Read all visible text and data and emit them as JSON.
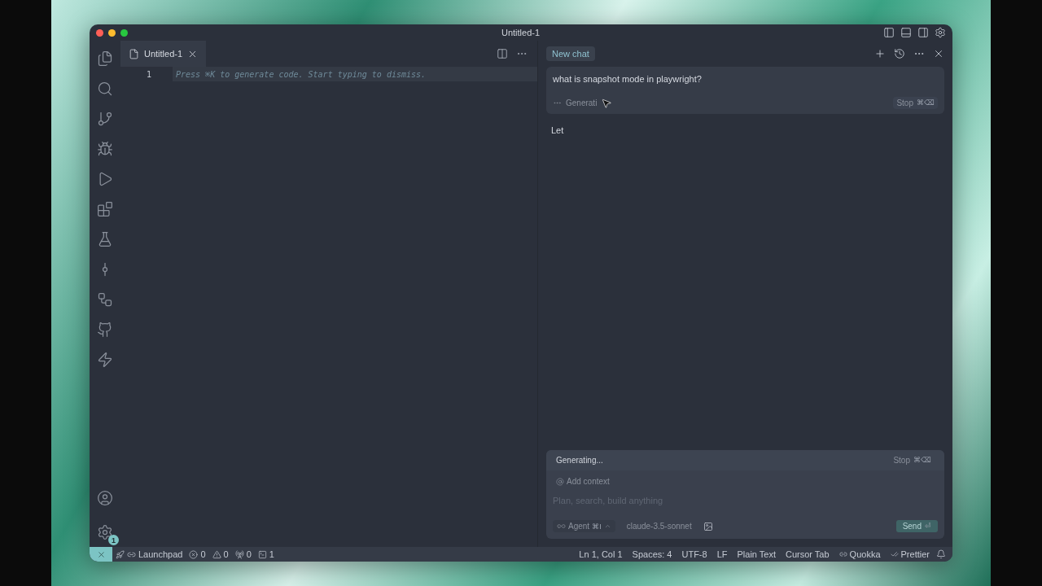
{
  "window": {
    "title": "Untitled-1"
  },
  "activity_bar": {
    "settings_badge": "1"
  },
  "editor": {
    "tabs": [
      {
        "label": "Untitled-1",
        "selected": true
      }
    ],
    "lines": [
      {
        "number": "1",
        "hint": "Press ⌘K to generate code. Start typing to dismiss."
      }
    ]
  },
  "chat": {
    "tab": "New chat",
    "message": "what is snapshot mode in playwright?",
    "status": "Generati",
    "stop": "Stop",
    "stop_shortcut": "⌘⌫",
    "response": "Let",
    "composer": {
      "status": "Generating...",
      "stop": "Stop",
      "stop_shortcut": "⌘⌫",
      "add_context": "Add context",
      "placeholder": "Plan, search, build anything",
      "mode": "Agent",
      "mode_shortcut": "⌘I",
      "model": "claude-3.5-sonnet",
      "send": "Send",
      "send_shortcut": "⏎"
    }
  },
  "status_bar": {
    "left": [
      {
        "kind": "launchpad",
        "label": "Launchpad"
      },
      {
        "kind": "errors",
        "label": "0"
      },
      {
        "kind": "warnings",
        "label": "0"
      },
      {
        "kind": "ports",
        "label": "0"
      },
      {
        "kind": "terminal",
        "label": "1"
      }
    ],
    "right": [
      {
        "kind": "text",
        "label": "Ln 1, Col 1"
      },
      {
        "kind": "text",
        "label": "Spaces: 4"
      },
      {
        "kind": "text",
        "label": "UTF-8"
      },
      {
        "kind": "text",
        "label": "LF"
      },
      {
        "kind": "text",
        "label": "Plain Text"
      },
      {
        "kind": "text",
        "label": "Cursor Tab"
      },
      {
        "kind": "quokka",
        "label": "Quokka"
      },
      {
        "kind": "prettier",
        "label": "Prettier"
      }
    ]
  }
}
